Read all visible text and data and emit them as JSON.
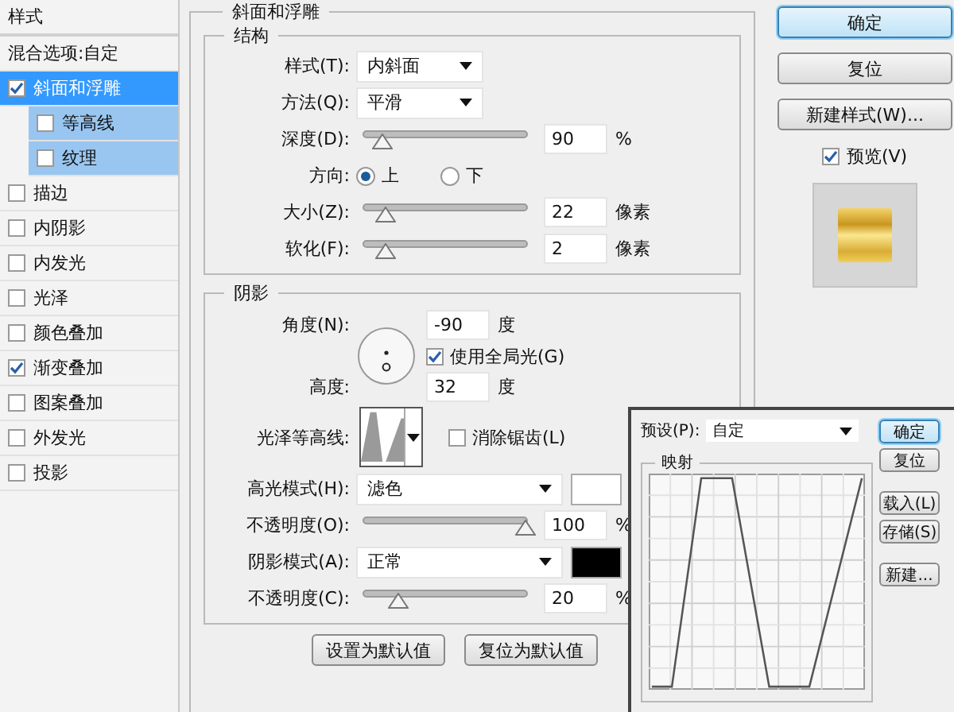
{
  "sidebar": {
    "title": "样式",
    "items": [
      {
        "label": "混合选项:自定",
        "kind": "plain",
        "selected": false
      },
      {
        "label": "斜面和浮雕",
        "kind": "check",
        "checked": true,
        "selected": true,
        "children": [
          {
            "label": "等高线",
            "kind": "check",
            "checked": false,
            "selected": false
          },
          {
            "label": "纹理",
            "kind": "check",
            "checked": false,
            "selected": false
          }
        ]
      },
      {
        "label": "描边",
        "kind": "check",
        "checked": false,
        "selected": false
      },
      {
        "label": "内阴影",
        "kind": "check",
        "checked": false,
        "selected": false
      },
      {
        "label": "内发光",
        "kind": "check",
        "checked": false,
        "selected": false
      },
      {
        "label": "光泽",
        "kind": "check",
        "checked": false,
        "selected": false
      },
      {
        "label": "颜色叠加",
        "kind": "check",
        "checked": false,
        "selected": false
      },
      {
        "label": "渐变叠加",
        "kind": "check",
        "checked": true,
        "selected": false
      },
      {
        "label": "图案叠加",
        "kind": "check",
        "checked": false,
        "selected": false
      },
      {
        "label": "外发光",
        "kind": "check",
        "checked": false,
        "selected": false
      },
      {
        "label": "投影",
        "kind": "check",
        "checked": false,
        "selected": false
      }
    ]
  },
  "bevel": {
    "title": "斜面和浮雕",
    "structure": {
      "title": "结构",
      "style": {
        "label": "样式(T):",
        "value": "内斜面"
      },
      "technique": {
        "label": "方法(Q):",
        "value": "平滑"
      },
      "depth": {
        "label": "深度(D):",
        "level": 0.1,
        "value": "90",
        "unit": "%"
      },
      "direction": {
        "label": "方向:",
        "options": [
          {
            "label": "上",
            "selected": true
          },
          {
            "label": "下",
            "selected": false
          }
        ]
      },
      "size": {
        "label": "大小(Z):",
        "level": 0.12,
        "value": "22",
        "unit": "像素"
      },
      "soften": {
        "label": "软化(F):",
        "level": 0.12,
        "value": "2",
        "unit": "像素"
      }
    },
    "shading": {
      "title": "阴影",
      "angle": {
        "label": "角度(N):",
        "value": "-90",
        "unit": "度"
      },
      "global_light": {
        "label": "使用全局光(G)",
        "checked": true
      },
      "altitude": {
        "label": "高度:",
        "value": "32",
        "unit": "度"
      },
      "gloss_contour": {
        "label": "光泽等高线:"
      },
      "anti_aliased": {
        "label": "消除锯齿(L)",
        "checked": false
      },
      "highlight_mode": {
        "label": "高光模式(H):",
        "value": "滤色",
        "color": "#ffffff"
      },
      "highlight_opacity": {
        "label": "不透明度(O):",
        "level": 1.0,
        "value": "100",
        "unit": "%"
      },
      "shadow_mode": {
        "label": "阴影模式(A):",
        "value": "正常",
        "color": "#000000"
      },
      "shadow_opacity": {
        "label": "不透明度(C):",
        "level": 0.2,
        "value": "20",
        "unit": "%"
      }
    },
    "buttons": [
      "设置为默认值",
      "复位为默认值"
    ]
  },
  "actions": {
    "buttons": [
      {
        "label": "确定",
        "default": true
      },
      {
        "label": "复位",
        "default": false
      },
      {
        "label": "新建样式(W)...",
        "default": false
      }
    ],
    "preview": {
      "label": "预览(V)",
      "checked": true
    }
  },
  "contour_editor": {
    "preset": {
      "label": "预设(P):",
      "value": "自定"
    },
    "mapping_title": "映射",
    "buttons": [
      {
        "label": "确定",
        "default": true
      },
      {
        "label": "复位",
        "default": false
      },
      {
        "label": "载入(L)",
        "default": false
      },
      {
        "label": "存储(S)",
        "default": false
      },
      {
        "label": "新建...",
        "default": false
      }
    ]
  }
}
